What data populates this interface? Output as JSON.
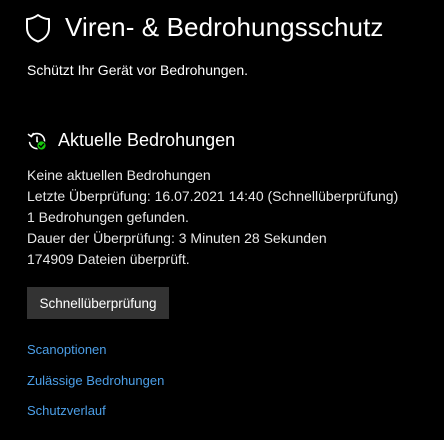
{
  "header": {
    "title": "Viren- & Bedrohungsschutz",
    "subtitle": "Schützt Ihr Gerät vor Bedrohungen.",
    "icon": "shield-icon"
  },
  "current_threats": {
    "title": "Aktuelle Bedrohungen",
    "icon": "history-icon",
    "status_color": "#16c60c",
    "lines": [
      "Keine aktuellen Bedrohungen",
      "Letzte Überprüfung: 16.07.2021 14:40 (Schnellüberprüfung)",
      "1 Bedrohungen gefunden.",
      "Dauer der Überprüfung: 3 Minuten 28 Sekunden",
      "174909 Dateien überprüft."
    ],
    "scan_button_label": "Schnellüberprüfung"
  },
  "links": {
    "scan_options": "Scanoptionen",
    "allowed_threats": "Zulässige Bedrohungen",
    "protection_history": "Schutzverlauf"
  },
  "colors": {
    "background": "#000000",
    "text": "#ffffff",
    "link": "#4c9fe8",
    "button_background": "#333333"
  }
}
